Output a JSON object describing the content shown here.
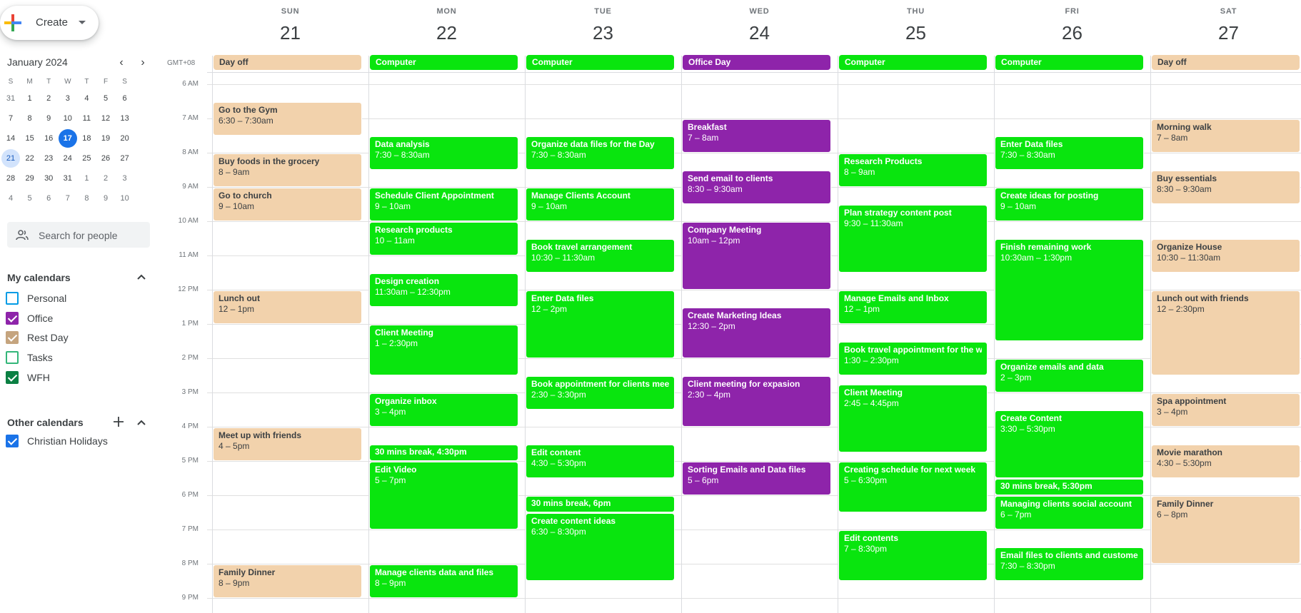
{
  "colors": {
    "wfh": "#09e50e",
    "office": "#8e24aa",
    "rest": "#f2d2ac",
    "today": "#1a73e8",
    "selected": "#d2e3fc"
  },
  "header": {
    "create_label": "Create",
    "create_icon": "multicolor-plus-icon"
  },
  "mini_calendar": {
    "month_label": "January 2024",
    "weekday_initials": [
      "S",
      "M",
      "T",
      "W",
      "T",
      "F",
      "S"
    ],
    "weeks": [
      [
        "31",
        "1",
        "2",
        "3",
        "4",
        "5",
        "6"
      ],
      [
        "7",
        "8",
        "9",
        "10",
        "11",
        "12",
        "13"
      ],
      [
        "14",
        "15",
        "16",
        "17",
        "18",
        "19",
        "20"
      ],
      [
        "21",
        "22",
        "23",
        "24",
        "25",
        "26",
        "27"
      ],
      [
        "28",
        "29",
        "30",
        "31",
        "1",
        "2",
        "3"
      ],
      [
        "4",
        "5",
        "6",
        "7",
        "8",
        "9",
        "10"
      ]
    ],
    "today": "17",
    "selected": "21"
  },
  "search_people": {
    "placeholder": "Search for people"
  },
  "my_calendars": {
    "title": "My calendars",
    "items": [
      {
        "label": "Personal",
        "color": "#039be5",
        "checked": false
      },
      {
        "label": "Office",
        "color": "#8e24aa",
        "checked": true
      },
      {
        "label": "Rest Day",
        "color": "#c5a47e",
        "checked": true
      },
      {
        "label": "Tasks",
        "color": "#33b679",
        "checked": false
      },
      {
        "label": "WFH",
        "color": "#0b8043",
        "checked": true
      }
    ]
  },
  "other_calendars": {
    "title": "Other calendars",
    "items": [
      {
        "label": "Christian Holidays",
        "color": "#1a73e8",
        "checked": true
      }
    ]
  },
  "timezone": "GMT+08",
  "hours": [
    "6 AM",
    "7 AM",
    "8 AM",
    "9 AM",
    "10 AM",
    "11 AM",
    "12 PM",
    "1 PM",
    "2 PM",
    "3 PM",
    "4 PM",
    "5 PM",
    "6 PM",
    "7 PM",
    "8 PM",
    "9 PM"
  ],
  "days": [
    {
      "dow": "SUN",
      "date": "21",
      "allday": {
        "title": "Day off",
        "cal": "rest"
      },
      "events": [
        {
          "title": "Go to the Gym",
          "time": "6:30 – 7:30am",
          "start": 6.5,
          "end": 7.5,
          "cal": "rest"
        },
        {
          "title": "Buy foods in the grocery",
          "time": "8 – 9am",
          "start": 8,
          "end": 9,
          "cal": "rest"
        },
        {
          "title": "Go to church",
          "time": "9 – 10am",
          "start": 9,
          "end": 10,
          "cal": "rest"
        },
        {
          "title": "Lunch out",
          "time": "12 – 1pm",
          "start": 12,
          "end": 13,
          "cal": "rest"
        },
        {
          "title": "Meet up with friends",
          "time": "4 – 5pm",
          "start": 16,
          "end": 17,
          "cal": "rest"
        },
        {
          "title": "Family Dinner",
          "time": "8 – 9pm",
          "start": 20,
          "end": 21,
          "cal": "rest"
        }
      ]
    },
    {
      "dow": "MON",
      "date": "22",
      "allday": {
        "title": "Computer",
        "cal": "wfh"
      },
      "events": [
        {
          "title": "Data analysis",
          "time": "7:30 – 8:30am",
          "start": 7.5,
          "end": 8.5,
          "cal": "wfh"
        },
        {
          "title": "Schedule Client Appointment",
          "time": "9 – 10am",
          "start": 9,
          "end": 10,
          "cal": "wfh"
        },
        {
          "title": "Research products",
          "time": "10 – 11am",
          "start": 10,
          "end": 11,
          "cal": "wfh"
        },
        {
          "title": "Design creation",
          "time": "11:30am – 12:30pm",
          "start": 11.5,
          "end": 12.5,
          "cal": "wfh"
        },
        {
          "title": "Client Meeting",
          "time": "1 – 2:30pm",
          "start": 13,
          "end": 14.5,
          "cal": "wfh"
        },
        {
          "title": "Organize inbox",
          "time": "3 – 4pm",
          "start": 15,
          "end": 16,
          "cal": "wfh"
        },
        {
          "title": "30 mins break, 4:30pm",
          "time": "",
          "start": 16.5,
          "end": 17,
          "cal": "wfh"
        },
        {
          "title": "Edit Video",
          "time": "5 – 7pm",
          "start": 17,
          "end": 19,
          "cal": "wfh"
        },
        {
          "title": "Manage clients data and files",
          "time": "8 – 9pm",
          "start": 20,
          "end": 21,
          "cal": "wfh"
        }
      ]
    },
    {
      "dow": "TUE",
      "date": "23",
      "allday": {
        "title": "Computer",
        "cal": "wfh"
      },
      "events": [
        {
          "title": "Organize data files for the Day",
          "time": "7:30 – 8:30am",
          "start": 7.5,
          "end": 8.5,
          "cal": "wfh"
        },
        {
          "title": "Manage Clients Account",
          "time": "9 – 10am",
          "start": 9,
          "end": 10,
          "cal": "wfh"
        },
        {
          "title": "Book travel arrangement",
          "time": "10:30 – 11:30am",
          "start": 10.5,
          "end": 11.5,
          "cal": "wfh"
        },
        {
          "title": "Enter Data files",
          "time": "12 – 2pm",
          "start": 12,
          "end": 14,
          "cal": "wfh"
        },
        {
          "title": "Book appointment for clients meeting",
          "time": "2:30 – 3:30pm",
          "start": 14.5,
          "end": 15.5,
          "cal": "wfh"
        },
        {
          "title": "Edit content",
          "time": "4:30 – 5:30pm",
          "start": 16.5,
          "end": 17.5,
          "cal": "wfh"
        },
        {
          "title": "30 mins break, 6pm",
          "time": "",
          "start": 18,
          "end": 18.5,
          "cal": "wfh"
        },
        {
          "title": "Create content ideas",
          "time": "6:30 – 8:30pm",
          "start": 18.5,
          "end": 20.5,
          "cal": "wfh"
        }
      ]
    },
    {
      "dow": "WED",
      "date": "24",
      "allday": {
        "title": "Office Day",
        "cal": "office"
      },
      "events": [
        {
          "title": "Breakfast",
          "time": "7 – 8am",
          "start": 7,
          "end": 8,
          "cal": "office"
        },
        {
          "title": "Send email to clients",
          "time": "8:30 – 9:30am",
          "start": 8.5,
          "end": 9.5,
          "cal": "office"
        },
        {
          "title": "Company Meeting",
          "time": "10am – 12pm",
          "start": 10,
          "end": 12,
          "cal": "office"
        },
        {
          "title": "Create Marketing Ideas",
          "time": "12:30 – 2pm",
          "start": 12.5,
          "end": 14,
          "cal": "office"
        },
        {
          "title": "Client meeting for expasion",
          "time": "2:30 – 4pm",
          "start": 14.5,
          "end": 16,
          "cal": "office"
        },
        {
          "title": "Sorting Emails and Data files",
          "time": "5 – 6pm",
          "start": 17,
          "end": 18,
          "cal": "office"
        }
      ]
    },
    {
      "dow": "THU",
      "date": "25",
      "allday": {
        "title": "Computer",
        "cal": "wfh"
      },
      "events": [
        {
          "title": "Research Products",
          "time": "8 – 9am",
          "start": 8,
          "end": 9,
          "cal": "wfh"
        },
        {
          "title": "Plan strategy content post",
          "time": "9:30 – 11:30am",
          "start": 9.5,
          "end": 11.5,
          "cal": "wfh"
        },
        {
          "title": "Manage Emails and Inbox",
          "time": "12 – 1pm",
          "start": 12,
          "end": 13,
          "cal": "wfh"
        },
        {
          "title": "Book travel appointment for the week",
          "time": "1:30 – 2:30pm",
          "start": 13.5,
          "end": 14.5,
          "cal": "wfh"
        },
        {
          "title": "Client Meeting",
          "time": "2:45 – 4:45pm",
          "start": 14.75,
          "end": 16.75,
          "cal": "wfh"
        },
        {
          "title": "Creating schedule for next week",
          "time": "5 – 6:30pm",
          "start": 17,
          "end": 18.5,
          "cal": "wfh"
        },
        {
          "title": "Edit contents",
          "time": "7 – 8:30pm",
          "start": 19,
          "end": 20.5,
          "cal": "wfh"
        }
      ]
    },
    {
      "dow": "FRI",
      "date": "26",
      "allday": {
        "title": "Computer",
        "cal": "wfh"
      },
      "events": [
        {
          "title": "Enter Data files",
          "time": "7:30 – 8:30am",
          "start": 7.5,
          "end": 8.5,
          "cal": "wfh"
        },
        {
          "title": "Create ideas for posting",
          "time": "9 – 10am",
          "start": 9,
          "end": 10,
          "cal": "wfh"
        },
        {
          "title": "Finish remaining work",
          "time": "10:30am – 1:30pm",
          "start": 10.5,
          "end": 13.5,
          "cal": "wfh"
        },
        {
          "title": "Organize emails and data",
          "time": "2 – 3pm",
          "start": 14,
          "end": 15,
          "cal": "wfh"
        },
        {
          "title": "Create Content",
          "time": "3:30 – 5:30pm",
          "start": 15.5,
          "end": 17.5,
          "cal": "wfh"
        },
        {
          "title": "30 mins break, 5:30pm",
          "time": "",
          "start": 17.5,
          "end": 18,
          "cal": "wfh"
        },
        {
          "title": "Managing clients social account",
          "time": "6 – 7pm",
          "start": 18,
          "end": 19,
          "cal": "wfh"
        },
        {
          "title": "Email files to clients and customer",
          "time": "7:30 – 8:30pm",
          "start": 19.5,
          "end": 20.5,
          "cal": "wfh"
        }
      ]
    },
    {
      "dow": "SAT",
      "date": "27",
      "allday": {
        "title": "Day off",
        "cal": "rest"
      },
      "events": [
        {
          "title": "Morning walk",
          "time": "7 – 8am",
          "start": 7,
          "end": 8,
          "cal": "rest"
        },
        {
          "title": "Buy essentials",
          "time": "8:30 – 9:30am",
          "start": 8.5,
          "end": 9.5,
          "cal": "rest"
        },
        {
          "title": "Organize House",
          "time": "10:30 – 11:30am",
          "start": 10.5,
          "end": 11.5,
          "cal": "rest"
        },
        {
          "title": "Lunch out with friends",
          "time": "12 – 2:30pm",
          "start": 12,
          "end": 14.5,
          "cal": "rest"
        },
        {
          "title": "Spa appointment",
          "time": "3 – 4pm",
          "start": 15,
          "end": 16,
          "cal": "rest"
        },
        {
          "title": "Movie marathon",
          "time": "4:30 – 5:30pm",
          "start": 16.5,
          "end": 17.5,
          "cal": "rest"
        },
        {
          "title": "Family Dinner",
          "time": "6 – 8pm",
          "start": 18,
          "end": 20,
          "cal": "rest"
        }
      ]
    }
  ]
}
